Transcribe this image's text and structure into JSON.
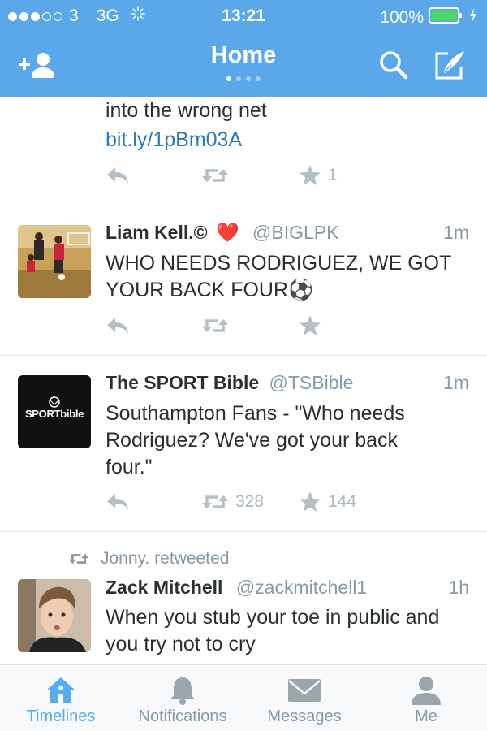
{
  "status_bar": {
    "carrier": "3",
    "network": "3G",
    "time": "13:21",
    "battery": "100%",
    "signal_bars_filled": 3,
    "signal_bars_total": 5
  },
  "nav": {
    "title": "Home",
    "page_dots": 4,
    "active_dot": 1
  },
  "tweets": [
    {
      "text_lines": [
        "into the wrong net"
      ],
      "link": "bit.ly/1pBm03A",
      "favorites": "1"
    },
    {
      "name": "Liam Kell.©",
      "emoji": "❤️",
      "handle": "@BIGLPK",
      "time": "1m",
      "text": "WHO NEEDS RODRIGUEZ, WE GOT YOUR BACK FOUR",
      "text_emoji": "⚽"
    },
    {
      "name": "The SPORT Bible",
      "handle": "@TSBible",
      "time": "1m",
      "text": "Southampton Fans - \"Who needs Rodriguez? We've got your back four.\"",
      "avatar_text": "SPORTbible",
      "retweets": "328",
      "favorites": "144"
    },
    {
      "retweeted_by": "Jonny. retweeted",
      "name": "Zack Mitchell",
      "handle": "@zackmitchell1",
      "time": "1h",
      "text": "When you stub your toe in public and you try not to cry"
    }
  ],
  "tabs": [
    {
      "label": "Timelines",
      "icon": "home-icon",
      "active": true
    },
    {
      "label": "Notifications",
      "icon": "bell-icon",
      "active": false
    },
    {
      "label": "Messages",
      "icon": "envelope-icon",
      "active": false
    },
    {
      "label": "Me",
      "icon": "person-icon",
      "active": false
    }
  ],
  "colors": {
    "header": "#5aa8ea",
    "link": "#2b7bb9",
    "active_tab": "#55acee",
    "muted": "#8899a6",
    "battery": "#4cd964"
  }
}
